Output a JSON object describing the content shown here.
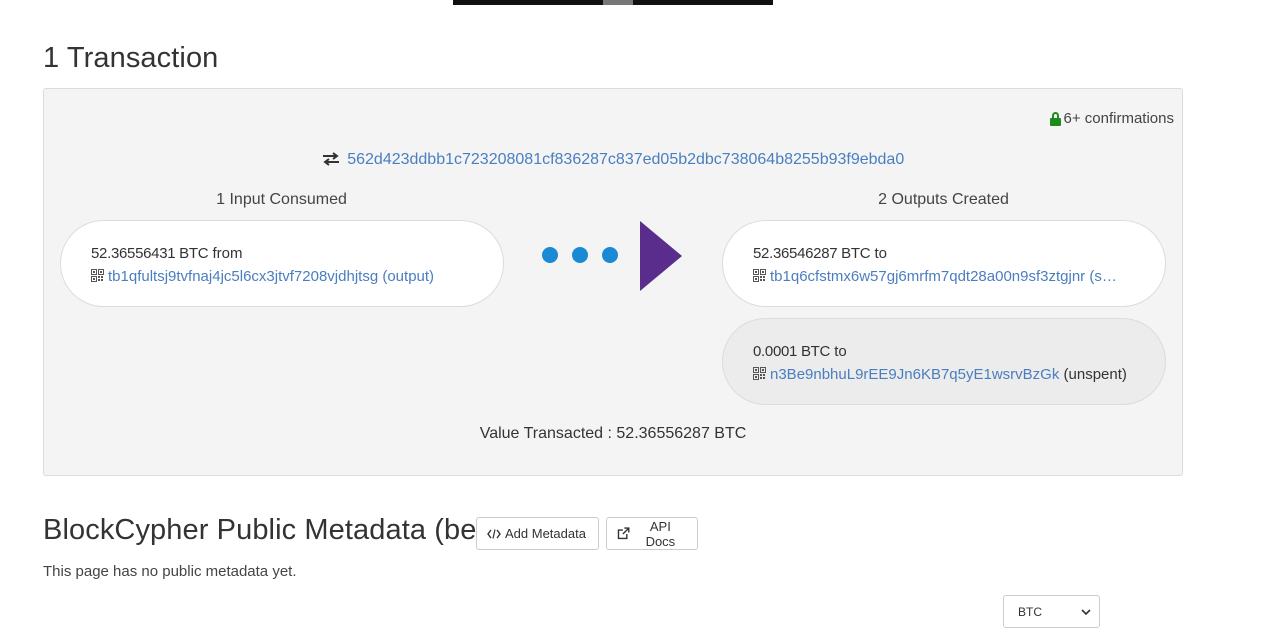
{
  "transactions_heading": "1 Transaction",
  "transaction": {
    "confirmations": "6+ confirmations",
    "hash": "562d423ddbb1c723208081cf836287c837ed05b2dbc738064b8255b93f9ebda0",
    "inputs_heading": "1 Input Consumed",
    "outputs_heading": "2 Outputs Created",
    "inputs": [
      {
        "amount": "52.36556431 BTC",
        "direction": "from",
        "address": "tb1qfultsj9tvfnaj4jc5l6cx3jtvf7208vjdhjtsg",
        "status": "(output)"
      }
    ],
    "outputs": [
      {
        "amount": "52.36546287 BTC",
        "direction": "to",
        "address": "tb1q6cfstmx6w57gj6mrfm7qdt28a00n9sf3ztgjnr",
        "status": "(s…"
      },
      {
        "amount": "0.0001 BTC",
        "direction": "to",
        "address": "n3Be9nbhuL9rEE9Jn6KB7q5yE1wsrvBzGk",
        "status": "(unspent)"
      }
    ],
    "value_label": "Value Transacted",
    "value_amount": ": 52.36556287 BTC"
  },
  "metadata": {
    "title": "BlockCypher Public Metadata (beta)",
    "add_button": "Add Metadata",
    "docs_button": "API Docs",
    "note": "This page has no public metadata yet."
  },
  "currency_select": {
    "selected": "BTC"
  },
  "colors": {
    "link": "#4a7ec0",
    "dot": "#1a8ad4",
    "arrow": "#5a2c8c",
    "lock": "#1e8a1e"
  }
}
